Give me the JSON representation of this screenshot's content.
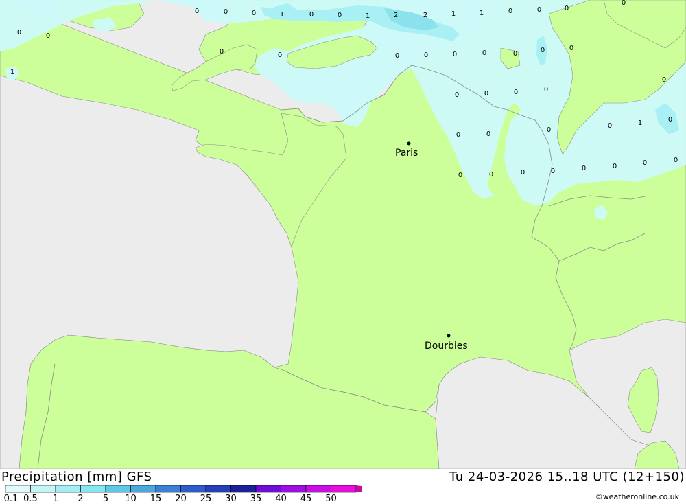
{
  "map": {
    "colors": {
      "sea": "#ececec",
      "land": "#ccff99",
      "precip_light": "#ccfafa",
      "precip_mid": "#a8f0f4",
      "precip_heavy": "#8ce2ec",
      "border": "#8a8a8a"
    },
    "cities": [
      {
        "name": "Paris"
      },
      {
        "name": "Dourbies"
      }
    ],
    "values": [
      "0",
      "0",
      "0",
      "1",
      "0",
      "0",
      "1",
      "2",
      "2",
      "1",
      "1",
      "0",
      "0",
      "0",
      "0",
      "0",
      "0",
      "0",
      "0",
      "0",
      "0",
      "0",
      "0",
      "0",
      "0",
      "0",
      "1",
      "0",
      "0",
      "0",
      "0",
      "0",
      "0",
      "0",
      "0",
      "0",
      "1",
      "0",
      "0",
      "0",
      "0",
      "0",
      "0",
      "0",
      "0",
      "0",
      "0",
      "0"
    ]
  },
  "footer": {
    "title_left": "Precipitation [mm] GFS",
    "title_right": "Tu 24-03-2026 15..18 UTC (12+150)",
    "credit": "©weatheronline.co.uk",
    "legend": {
      "labels": [
        "0.1",
        "0.5",
        "1",
        "2",
        "5",
        "10",
        "15",
        "20",
        "25",
        "30",
        "35",
        "40",
        "45",
        "50"
      ],
      "colors": [
        "#e1fbfc",
        "#c2f5f8",
        "#a3eef3",
        "#84e6ee",
        "#5fc9e5",
        "#4ba7de",
        "#3c7fd6",
        "#2f5ccb",
        "#2640b8",
        "#1d1e99",
        "#6f0fd6",
        "#9d0fe0",
        "#c80fe6",
        "#e40fd8",
        "#c0119e"
      ]
    }
  }
}
